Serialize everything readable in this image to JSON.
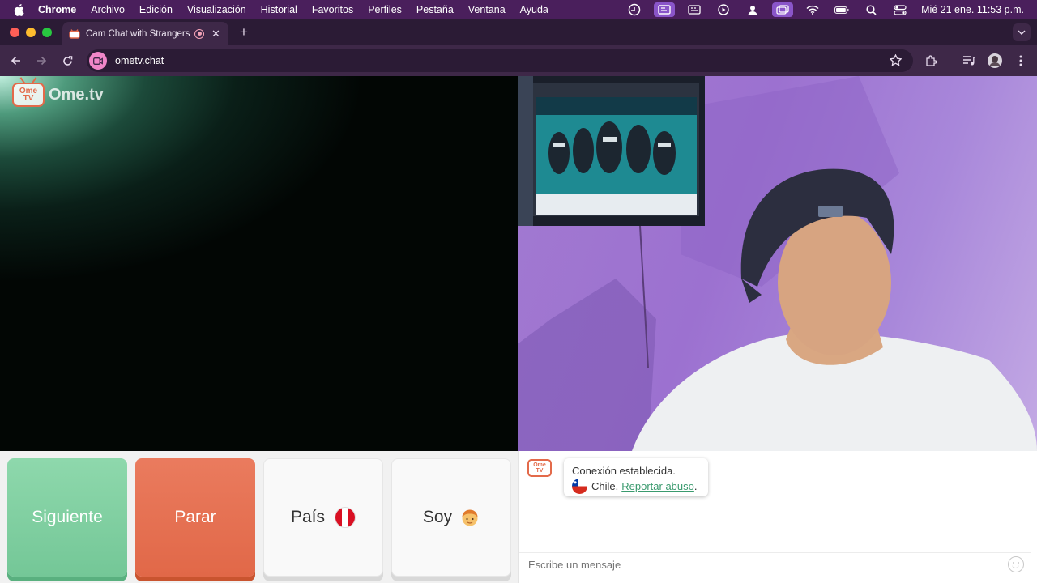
{
  "menubar": {
    "app": "Chrome",
    "items": [
      "Archivo",
      "Edición",
      "Visualización",
      "Historial",
      "Favoritos",
      "Perfiles",
      "Pestaña",
      "Ventana",
      "Ayuda"
    ],
    "clock": "Mié 21 ene.  11:53 p.m."
  },
  "tab": {
    "title": "Cam Chat with Strangers"
  },
  "omnibox": {
    "url": "ometv.chat"
  },
  "logo": {
    "tv_text": "Ome TV",
    "brand": "Ome.tv"
  },
  "controls": {
    "next_label": "Siguiente",
    "stop_label": "Parar",
    "country_label": "País",
    "gender_label": "Soy"
  },
  "chat": {
    "logo_text": "Ome TV",
    "status": "Conexión establecida.",
    "country": "Chile.",
    "report_link": "Reportar abuso",
    "report_suffix": ".",
    "input_placeholder": "Escribe un mensaje"
  },
  "colors": {
    "next": "#7fcf9f",
    "stop": "#e5704f",
    "link": "#3a9a6e",
    "browser_frame": "#3e2848"
  }
}
